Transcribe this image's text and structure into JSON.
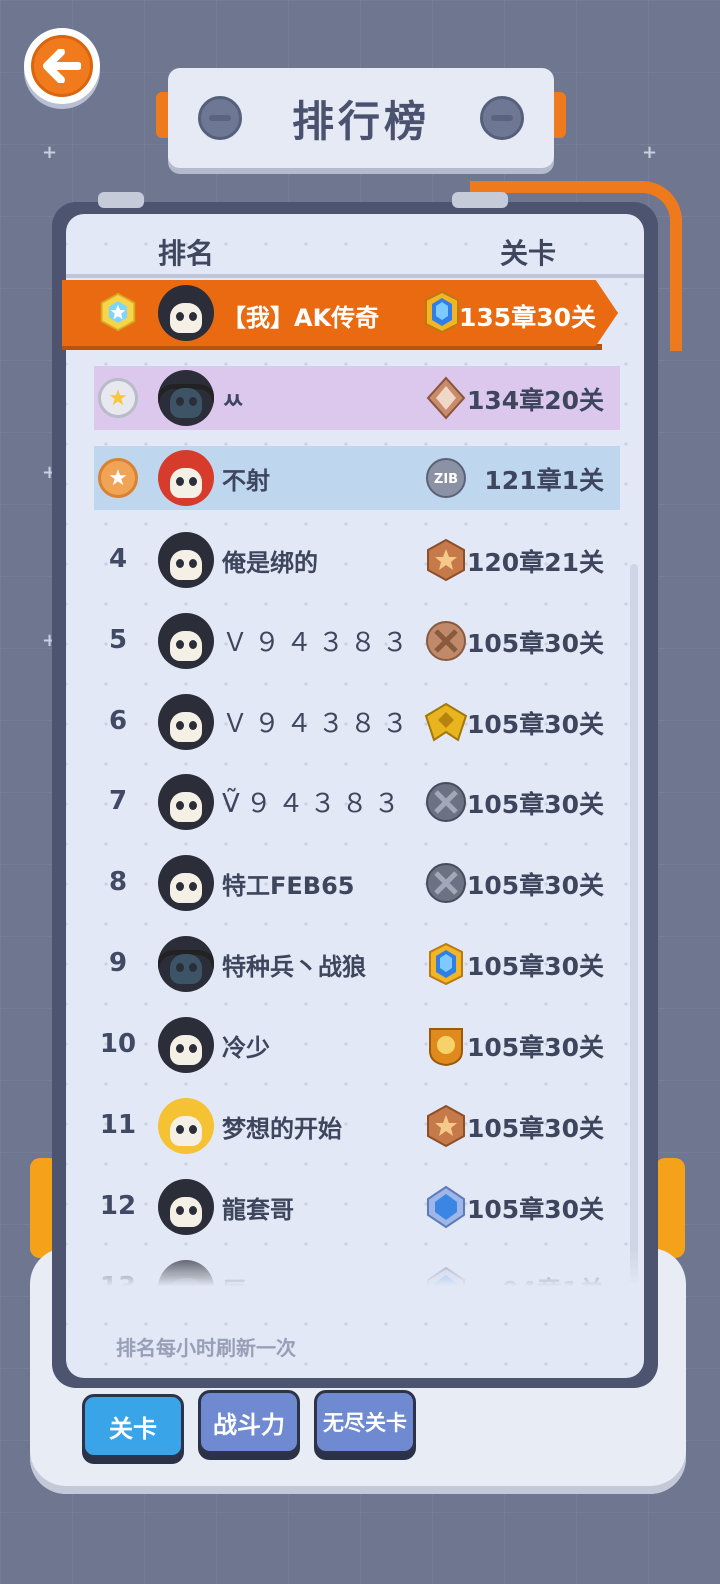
{
  "title": "排行榜",
  "header": {
    "rank_label": "排名",
    "level_label": "关卡"
  },
  "me": {
    "name": "【我】AK传奇",
    "level": "135章30关",
    "badge": "blue-gem-badge"
  },
  "rows": [
    {
      "rank": "",
      "medal": "gold",
      "name": "ㅆ",
      "level": "134章20关",
      "badge": "bronze-diamond-badge",
      "avatar": "gasmask"
    },
    {
      "rank": "",
      "medal": "bronze",
      "name": "不射",
      "level": "121章1关",
      "badge": "zib-badge",
      "avatar": "red"
    },
    {
      "rank": "4",
      "name": "俺是绑的",
      "level": "120章21关",
      "badge": "bronze-star-badge",
      "avatar": "reaper"
    },
    {
      "rank": "5",
      "name": "Ｖ９４３８３",
      "level": "105章30关",
      "badge": "bronze-cross-badge",
      "avatar": "reaper"
    },
    {
      "rank": "6",
      "name": "Ｖ９４３８３",
      "level": "105章30关",
      "badge": "gold-wings-badge",
      "avatar": "reaper"
    },
    {
      "rank": "7",
      "name": "Ṽ９４３８３",
      "level": "105章30关",
      "badge": "gray-cross-badge",
      "avatar": "reaper"
    },
    {
      "rank": "8",
      "name": "特工FEB65",
      "level": "105章30关",
      "badge": "gray-cross-badge",
      "avatar": "reaper"
    },
    {
      "rank": "9",
      "name": "特种兵丶战狼",
      "level": "105章30关",
      "badge": "blue-gem-badge",
      "avatar": "gasmask"
    },
    {
      "rank": "10",
      "name": "冷少",
      "level": "105章30关",
      "badge": "skull-shield-badge",
      "avatar": "reaper"
    },
    {
      "rank": "11",
      "name": "梦想的开始",
      "level": "105章30关",
      "badge": "bronze-star-badge",
      "avatar": "yellow"
    },
    {
      "rank": "12",
      "name": "龍套哥",
      "level": "105章30关",
      "badge": "blue-diamond-badge",
      "avatar": "reaper"
    },
    {
      "rank": "13",
      "name": "辰",
      "level": "94章1关",
      "badge": "silver-gem-badge",
      "avatar": "gasmask"
    }
  ],
  "refresh_note": "排名每小时刷新一次",
  "tabs": [
    "关卡",
    "战斗力",
    "无尽关卡"
  ],
  "colors": {
    "accent": "#EA6A12",
    "active_tab": "#3AA4E8",
    "inactive_tab": "#6F8AD0",
    "board": "#E3E8F6"
  }
}
